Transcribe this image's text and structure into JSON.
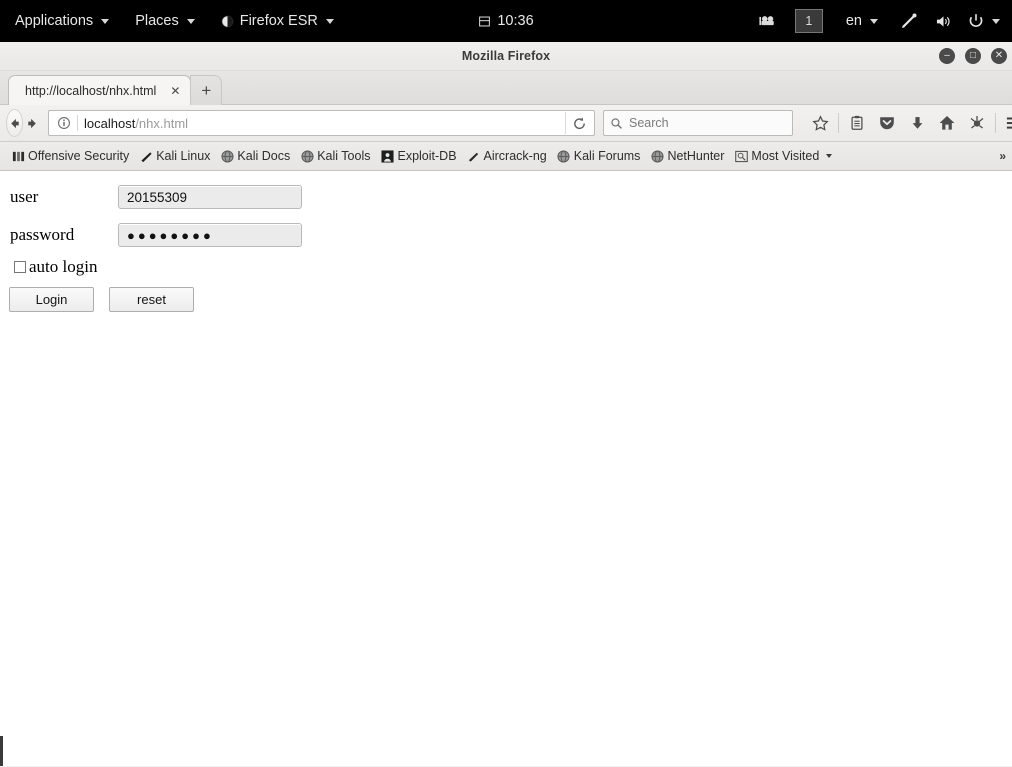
{
  "desktop_panel": {
    "applications_label": "Applications",
    "places_label": "Places",
    "firefox_label": "Firefox ESR",
    "clock": "10:36",
    "workspace": "1",
    "language": "en",
    "icons": {
      "calendar": "calendar-icon",
      "screencast": "screencast-icon",
      "pen": "pen-icon",
      "volume": "volume-icon",
      "power": "power-icon"
    }
  },
  "window": {
    "title": "Mozilla Firefox",
    "controls": {
      "minimize": "–",
      "maximize": "□",
      "close": "✕"
    }
  },
  "tabs": {
    "items": [
      {
        "label": "http://localhost/nhx.html",
        "close": "✕"
      }
    ],
    "new_tab": "+"
  },
  "navbar": {
    "back": "←",
    "forward": "→",
    "identity_icon": "info-icon",
    "url_host": "localhost",
    "url_path": "/nhx.html",
    "reload": "⟳",
    "search_placeholder": "Search",
    "icons": [
      "bookmark-star-icon",
      "reader-list-icon",
      "pocket-icon",
      "downloads-icon",
      "home-icon",
      "tracker-icon",
      "menu-icon"
    ]
  },
  "bookmarks": {
    "items": [
      {
        "label": "Offensive Security",
        "favicon": "offsec-icon"
      },
      {
        "label": "Kali Linux",
        "favicon": "kali-dragon-icon"
      },
      {
        "label": "Kali Docs",
        "favicon": "globe-icon"
      },
      {
        "label": "Kali Tools",
        "favicon": "globe-icon"
      },
      {
        "label": "Exploit-DB",
        "favicon": "exploitdb-icon"
      },
      {
        "label": "Aircrack-ng",
        "favicon": "aircrack-icon"
      },
      {
        "label": "Kali Forums",
        "favicon": "globe-icon"
      },
      {
        "label": "NetHunter",
        "favicon": "globe-icon"
      },
      {
        "label": "Most Visited",
        "favicon": "most-visited-icon"
      }
    ],
    "overflow": "»"
  },
  "page": {
    "user_label": "user",
    "user_value": "20155309",
    "password_label": "password",
    "password_value": "●●●●●●●●",
    "auto_login_label": "auto login",
    "login_button": "Login",
    "reset_button": "reset"
  }
}
